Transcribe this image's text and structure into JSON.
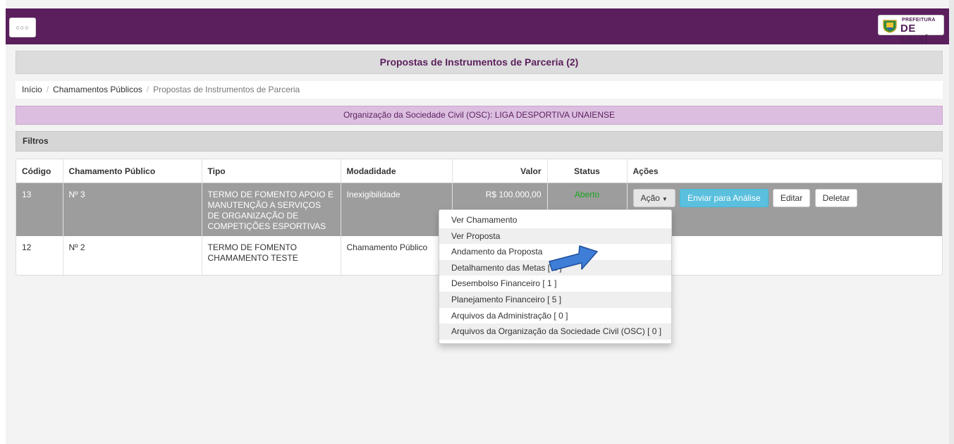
{
  "header": {
    "menu_label": "○○○",
    "logo_line1": "PREFEITURA",
    "logo_line2": "DE UNAÍ"
  },
  "page_title": "Propostas de Instrumentos de Parceria (2)",
  "breadcrumb": {
    "items": [
      "Início",
      "Chamamentos Públicos"
    ],
    "current": "Propostas de Instrumentos de Parceria"
  },
  "osc_label": "Organização da Sociedade Civil (OSC): LIGA DESPORTIVA UNAIENSE",
  "filters_label": "Filtros",
  "table": {
    "headers": [
      "Código",
      "Chamamento Público",
      "Tipo",
      "Modadidade",
      "Valor",
      "Status",
      "Ações"
    ],
    "rows": [
      {
        "codigo": "13",
        "chamamento": "Nº 3",
        "tipo": "TERMO DE FOMENTO APOIO E MANUTENÇÃO A SERVIÇOS DE ORGANIZAÇÃO DE COMPETIÇÕES ESPORTIVAS",
        "modalidade": "Inexigibilidade",
        "valor": "R$ 100.000,00",
        "status": "Aberto"
      },
      {
        "codigo": "12",
        "chamamento": "Nº 2",
        "tipo": "TERMO DE FOMENTO CHAMAMENTO TESTE",
        "modalidade": "Chamamento Público",
        "valor": "",
        "status": ""
      }
    ],
    "actions": {
      "acao": "Ação",
      "enviar": "Enviar para Análise",
      "editar": "Editar",
      "deletar": "Deletar"
    }
  },
  "dropdown_items": [
    "Ver Chamamento",
    "Ver Proposta",
    "Andamento da Proposta",
    "Detalhamento das Metas [ 2 ]",
    "Desembolso Financeiro [ 1 ]",
    "Planejamento Financeiro [ 5 ]",
    "Arquivos da Administração [ 0 ]",
    "Arquivos da Organização da Sociedade Civil (OSC) [ 0 ]"
  ],
  "colors": {
    "header_purple": "#5b1f5d",
    "osc_bar": "#dcbfe0",
    "status_green": "#19a51f",
    "enviar_button": "#5bc0de",
    "annotation_arrow": "#3f7ed6"
  },
  "icons": [
    "menu-dots-icon",
    "prefeitura-crest-icon",
    "caret-down-icon",
    "annotation-arrow-icon"
  ]
}
